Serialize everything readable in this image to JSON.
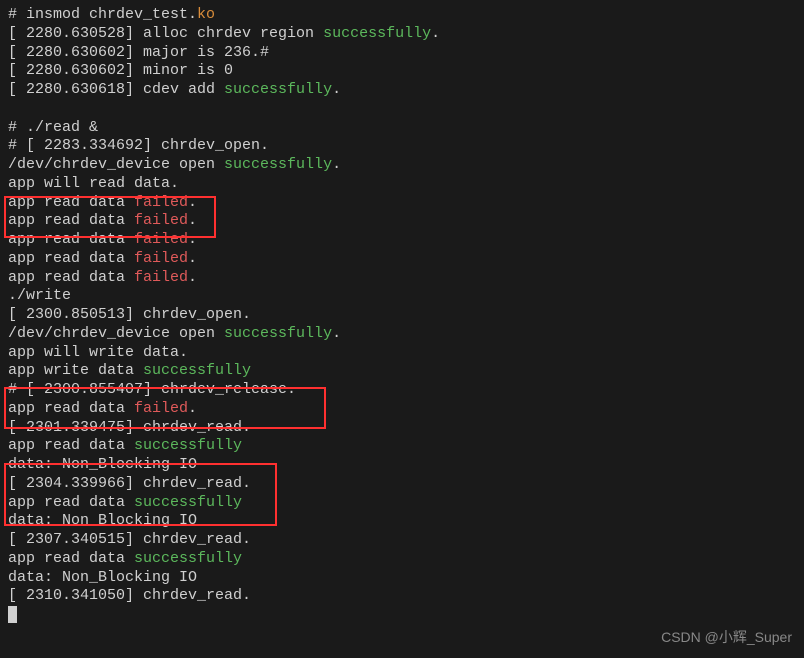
{
  "lines": [
    {
      "segments": [
        {
          "text": "# insmod chrdev_test.",
          "cls": "gray"
        },
        {
          "text": "ko",
          "cls": "orange"
        }
      ]
    },
    {
      "segments": [
        {
          "text": "[ 2280.630528] alloc chrdev region ",
          "cls": "gray"
        },
        {
          "text": "successfully",
          "cls": "green"
        },
        {
          "text": ".",
          "cls": "gray"
        }
      ]
    },
    {
      "segments": [
        {
          "text": "[ 2280.630602] major is 236.#",
          "cls": "gray"
        }
      ]
    },
    {
      "segments": [
        {
          "text": "[ 2280.630602] minor is 0",
          "cls": "gray"
        }
      ]
    },
    {
      "segments": [
        {
          "text": "[ 2280.630618] cdev add ",
          "cls": "gray"
        },
        {
          "text": "successfully",
          "cls": "green"
        },
        {
          "text": ".",
          "cls": "gray"
        }
      ]
    },
    {
      "segments": [
        {
          "text": " ",
          "cls": "gray"
        }
      ]
    },
    {
      "segments": [
        {
          "text": "# ./read &",
          "cls": "gray"
        }
      ]
    },
    {
      "segments": [
        {
          "text": "# [ 2283.334692] chrdev_open.",
          "cls": "gray"
        }
      ]
    },
    {
      "segments": [
        {
          "text": "/dev/chrdev_device open ",
          "cls": "gray"
        },
        {
          "text": "successfully",
          "cls": "green"
        },
        {
          "text": ".",
          "cls": "gray"
        }
      ]
    },
    {
      "segments": [
        {
          "text": "app will read data.",
          "cls": "gray"
        }
      ]
    },
    {
      "segments": [
        {
          "text": "app read data ",
          "cls": "gray"
        },
        {
          "text": "failed",
          "cls": "red"
        },
        {
          "text": ".",
          "cls": "gray"
        }
      ]
    },
    {
      "segments": [
        {
          "text": "app read data ",
          "cls": "gray"
        },
        {
          "text": "failed",
          "cls": "red"
        },
        {
          "text": ".",
          "cls": "gray"
        }
      ]
    },
    {
      "segments": [
        {
          "text": "app read data ",
          "cls": "gray"
        },
        {
          "text": "failed",
          "cls": "red"
        },
        {
          "text": ".",
          "cls": "gray"
        }
      ]
    },
    {
      "segments": [
        {
          "text": "app read data ",
          "cls": "gray"
        },
        {
          "text": "failed",
          "cls": "red"
        },
        {
          "text": ".",
          "cls": "gray"
        }
      ]
    },
    {
      "segments": [
        {
          "text": "app read data ",
          "cls": "gray"
        },
        {
          "text": "failed",
          "cls": "red"
        },
        {
          "text": ".",
          "cls": "gray"
        }
      ]
    },
    {
      "segments": [
        {
          "text": "./write",
          "cls": "gray"
        }
      ]
    },
    {
      "segments": [
        {
          "text": "[ 2300.850513] chrdev_open.",
          "cls": "gray"
        }
      ]
    },
    {
      "segments": [
        {
          "text": "/dev/chrdev_device open ",
          "cls": "gray"
        },
        {
          "text": "successfully",
          "cls": "green"
        },
        {
          "text": ".",
          "cls": "gray"
        }
      ]
    },
    {
      "segments": [
        {
          "text": "app will write data.",
          "cls": "gray"
        }
      ]
    },
    {
      "segments": [
        {
          "text": "app write data ",
          "cls": "gray"
        },
        {
          "text": "successfully",
          "cls": "green"
        }
      ]
    },
    {
      "segments": [
        {
          "text": "# [ 2300.855407] chrdev_release.",
          "cls": "gray"
        }
      ]
    },
    {
      "segments": [
        {
          "text": "app read data ",
          "cls": "gray"
        },
        {
          "text": "failed",
          "cls": "red"
        },
        {
          "text": ".",
          "cls": "gray"
        }
      ]
    },
    {
      "segments": [
        {
          "text": "[ 2301.339475] chrdev_read.",
          "cls": "gray"
        }
      ]
    },
    {
      "segments": [
        {
          "text": "app read data ",
          "cls": "gray"
        },
        {
          "text": "successfully",
          "cls": "green"
        }
      ]
    },
    {
      "segments": [
        {
          "text": "data: Non_Blocking IO",
          "cls": "gray"
        }
      ]
    },
    {
      "segments": [
        {
          "text": "[ 2304.339966] chrdev_read.",
          "cls": "gray"
        }
      ]
    },
    {
      "segments": [
        {
          "text": "app read data ",
          "cls": "gray"
        },
        {
          "text": "successfully",
          "cls": "green"
        }
      ]
    },
    {
      "segments": [
        {
          "text": "data: Non_Blocking IO",
          "cls": "gray"
        }
      ]
    },
    {
      "segments": [
        {
          "text": "[ 2307.340515] chrdev_read.",
          "cls": "gray"
        }
      ]
    },
    {
      "segments": [
        {
          "text": "app read data ",
          "cls": "gray"
        },
        {
          "text": "successfully",
          "cls": "green"
        }
      ]
    },
    {
      "segments": [
        {
          "text": "data: Non_Blocking IO",
          "cls": "gray"
        }
      ]
    },
    {
      "segments": [
        {
          "text": "[ 2310.341050] chrdev_read.",
          "cls": "gray"
        }
      ]
    }
  ],
  "watermark": "CSDN @小辉_Super"
}
